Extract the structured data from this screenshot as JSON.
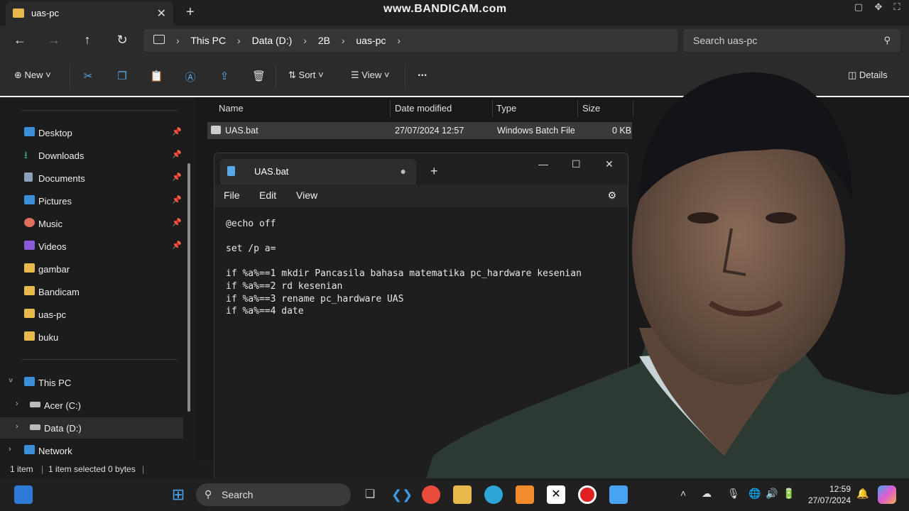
{
  "window": {
    "tab_title": "uas-pc",
    "watermark": "www.BANDICAM.com"
  },
  "address": {
    "crumbs": [
      "This PC",
      "Data (D:)",
      "2B",
      "uas-pc"
    ],
    "search_placeholder": "Search uas-pc"
  },
  "commands": {
    "new": "New",
    "sort": "Sort",
    "view": "View",
    "more": "...",
    "details": "Details"
  },
  "sidebar": {
    "quick": [
      {
        "label": "Desktop",
        "icon": "desktop-icon",
        "pinned": true
      },
      {
        "label": "Downloads",
        "icon": "download-icon",
        "pinned": true
      },
      {
        "label": "Documents",
        "icon": "document-icon",
        "pinned": true
      },
      {
        "label": "Pictures",
        "icon": "picture-icon",
        "pinned": true
      },
      {
        "label": "Music",
        "icon": "music-icon",
        "pinned": true
      },
      {
        "label": "Videos",
        "icon": "video-icon",
        "pinned": true
      },
      {
        "label": "gambar",
        "icon": "folder-icon",
        "pinned": false
      },
      {
        "label": "Bandicam",
        "icon": "folder-icon",
        "pinned": false
      },
      {
        "label": "uas-pc",
        "icon": "folder-icon",
        "pinned": false
      },
      {
        "label": "buku",
        "icon": "folder-icon",
        "pinned": false
      }
    ],
    "this_pc": "This PC",
    "drive_c": "Acer (C:)",
    "drive_d": "Data (D:)",
    "network": "Network"
  },
  "filelist": {
    "headers": {
      "name": "Name",
      "date": "Date modified",
      "type": "Type",
      "size": "Size"
    },
    "files": [
      {
        "name": "UAS.bat",
        "date": "27/07/2024 12:57",
        "type": "Windows Batch File",
        "size": "0 KB"
      }
    ]
  },
  "status": {
    "count": "1 item",
    "selected": "1 item selected  0 bytes"
  },
  "notepad": {
    "tab_title": "UAS.bat",
    "unsaved_marker": "●",
    "menu": {
      "file": "File",
      "edit": "Edit",
      "view": "View"
    },
    "content": "@echo off\n\nset /p a=\n\nif %a%==1 mkdir Pancasila bahasa matematika pc_hardware kesenian\nif %a%==2 rd kesenian\nif %a%==3 rename pc_hardware UAS\nif %a%==4 date"
  },
  "taskbar": {
    "search_label": "Search",
    "time": "12:59",
    "date": "27/07/2024"
  }
}
